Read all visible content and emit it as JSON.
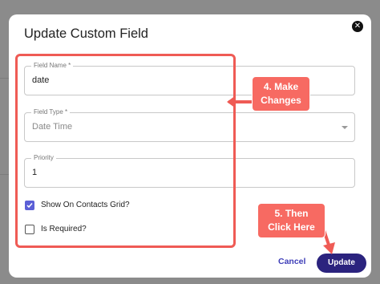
{
  "modal": {
    "title": "Update Custom Field",
    "close_icon": "close-icon"
  },
  "form": {
    "field_name": {
      "label": "Field Name *",
      "value": "date"
    },
    "field_type": {
      "label": "Field Type *",
      "value": "Date Time"
    },
    "priority": {
      "label": "Priority",
      "value": "1"
    },
    "show_on_contacts_grid": {
      "label": "Show On Contacts Grid?",
      "checked": true
    },
    "is_required": {
      "label": "Is Required?",
      "checked": false
    }
  },
  "actions": {
    "cancel_label": "Cancel",
    "update_label": "Update"
  },
  "annotations": {
    "callout_4": {
      "line1": "4. Make",
      "line2": "Changes"
    },
    "callout_5": {
      "line1": "5. Then",
      "line2": "Click Here"
    }
  },
  "colors": {
    "annotation_red": "#ef5b55",
    "callout_fill": "#f76a62",
    "primary_button": "#2b237e",
    "checkbox_checked": "#5b5fd6",
    "cancel_text": "#3d3db8"
  }
}
